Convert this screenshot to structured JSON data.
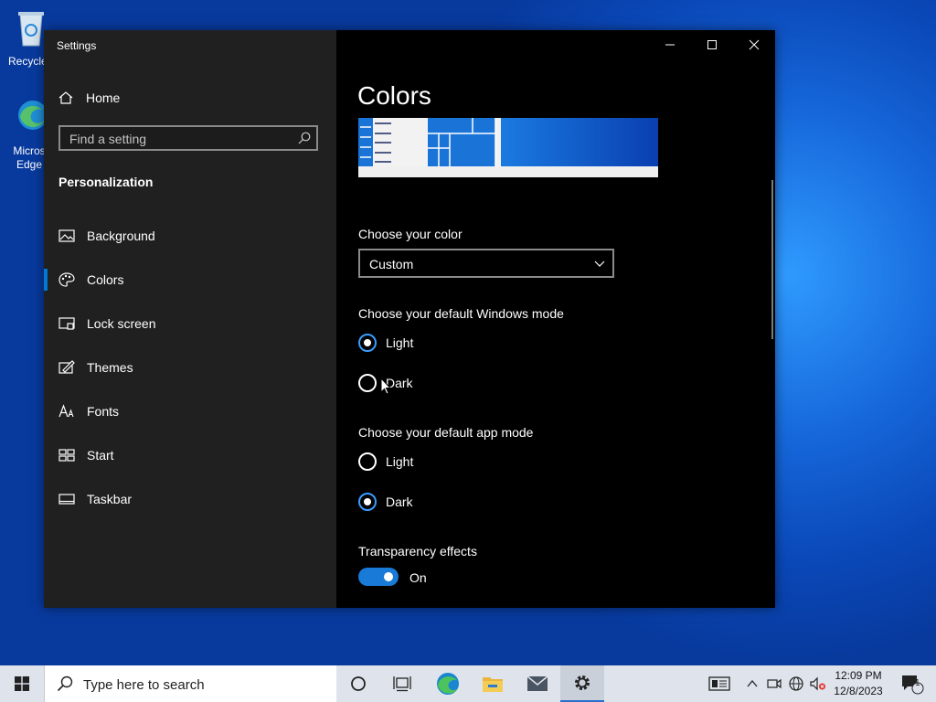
{
  "desktop": {
    "icons": [
      {
        "label": "Recycle"
      },
      {
        "label": "Micros Edge"
      }
    ]
  },
  "window": {
    "title": "Settings",
    "controls": {
      "minimize": "minimize-icon",
      "maximize": "maximize-icon",
      "close": "close-icon"
    }
  },
  "sidebar": {
    "home_label": "Home",
    "search_placeholder": "Find a setting",
    "section_title": "Personalization",
    "items": [
      {
        "label": "Background",
        "icon": "picture-icon"
      },
      {
        "label": "Colors",
        "icon": "palette-icon",
        "active": true
      },
      {
        "label": "Lock screen",
        "icon": "lock-screen-icon"
      },
      {
        "label": "Themes",
        "icon": "themes-icon"
      },
      {
        "label": "Fonts",
        "icon": "fonts-icon"
      },
      {
        "label": "Start",
        "icon": "start-icon"
      },
      {
        "label": "Taskbar",
        "icon": "taskbar-icon"
      }
    ]
  },
  "content": {
    "title": "Colors",
    "choose_color_label": "Choose your color",
    "color_dropdown_value": "Custom",
    "windows_mode": {
      "label": "Choose your default Windows mode",
      "options": [
        {
          "label": "Light",
          "selected": true
        },
        {
          "label": "Dark",
          "selected": false
        }
      ]
    },
    "app_mode": {
      "label": "Choose your default app mode",
      "options": [
        {
          "label": "Light",
          "selected": false
        },
        {
          "label": "Dark",
          "selected": true
        }
      ]
    },
    "transparency": {
      "label": "Transparency effects",
      "state": "On"
    }
  },
  "taskbar": {
    "search_placeholder": "Type here to search",
    "time": "12:09 PM",
    "date": "12/8/2023",
    "notification_count": "1"
  },
  "colors": {
    "accent": "#0078d4",
    "sidebar_bg": "#202020",
    "content_bg": "#000000"
  }
}
